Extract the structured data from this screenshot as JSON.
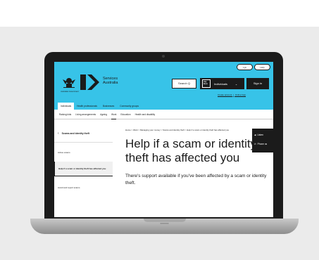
{
  "header": {
    "lang_options": [
      "Lgs",
      "Help"
    ],
    "crest_text": "Australian Government",
    "service_name": "Services Australia",
    "search_label": "Search Q",
    "mygov": {
      "logo": "my Gov",
      "selector": "Individuals",
      "chevron": "⌄"
    },
    "signin_label": "Sign in",
    "links": [
      "Create account",
      "Online help"
    ],
    "link_separator": "|",
    "audience_tabs": [
      "Individuals",
      "Health professionals",
      "Businesses",
      "Community groups"
    ],
    "active_audience": 0
  },
  "subnav": {
    "items": [
      "Raising kids",
      "Living arrangements",
      "Ageing",
      "Work",
      "Education",
      "Health and disability"
    ],
    "active": 3
  },
  "sidebar": {
    "back_arrow": "‹",
    "back_label": "Scams and identity theft",
    "items": [
      "Active scams",
      "Help if a scam or identity theft has affected you",
      "Avoid and report scams"
    ],
    "active": 1
  },
  "main": {
    "breadcrumb": "Home > Work > Managing your money > Scams and identity theft > Help if a scam or identity theft has affected you",
    "title": "Help if a scam or identity theft has affected you",
    "lead": "There's support available if you've been affected by a scam or identity theft."
  },
  "tools": {
    "listen_icon": "◀",
    "listen_label": "Listen",
    "phone_icon": "✆",
    "phone_label": "Phone us"
  },
  "device": {
    "base_label": "XXXXXX"
  },
  "colors": {
    "header": "#37c3e8",
    "dark": "#1b1b1b"
  }
}
